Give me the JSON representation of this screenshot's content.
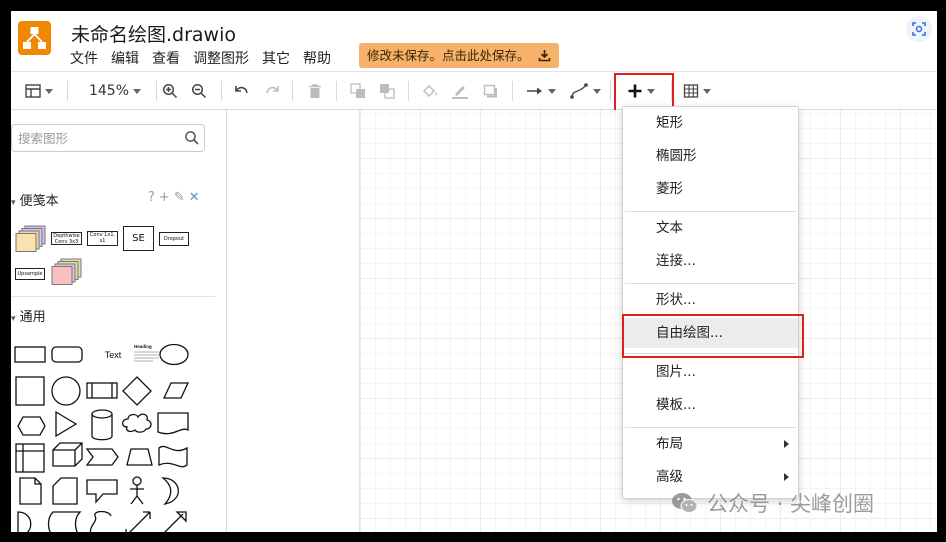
{
  "app": {
    "title": "未命名绘图.drawio",
    "menus": [
      "文件",
      "编辑",
      "查看",
      "调整图形",
      "其它",
      "帮助"
    ],
    "save_notice": "修改未保存。点击此处保存。",
    "accent": "#f08705",
    "highlight": "#e02020"
  },
  "toolbar": {
    "zoom": "145%",
    "icons": [
      "format-panel-icon",
      "zoom-in-icon",
      "zoom-out-icon",
      "undo-icon",
      "redo-icon",
      "delete-icon",
      "to-front-icon",
      "to-back-icon",
      "fill-color-icon",
      "line-color-icon",
      "shadow-icon",
      "connection-icon",
      "waypoints-icon",
      "insert-plus-icon",
      "table-icon"
    ]
  },
  "sidebar": {
    "search_placeholder": "搜索图形",
    "scratchpad": {
      "title": "便笺本",
      "tools": [
        "?",
        "+",
        "✎",
        "✕"
      ],
      "shapes": [
        "Depthwise Conv 3x3",
        "Conv 1x1, s1",
        "SE",
        "Dropout",
        "Upsample"
      ]
    },
    "general": {
      "title": "通用",
      "text_shape": "Text",
      "heading_shape": "Heading"
    }
  },
  "insert_menu": {
    "items": [
      {
        "label": "矩形"
      },
      {
        "label": "椭圆形"
      },
      {
        "label": "菱形"
      },
      {
        "label": "文本"
      },
      {
        "label": "连接..."
      },
      {
        "label": "形状..."
      },
      {
        "label": "自由绘图..."
      },
      {
        "label": "图片..."
      },
      {
        "label": "模板..."
      },
      {
        "label": "布局"
      },
      {
        "label": "高级"
      }
    ]
  },
  "watermark": "公众号 · 尖峰创圈"
}
